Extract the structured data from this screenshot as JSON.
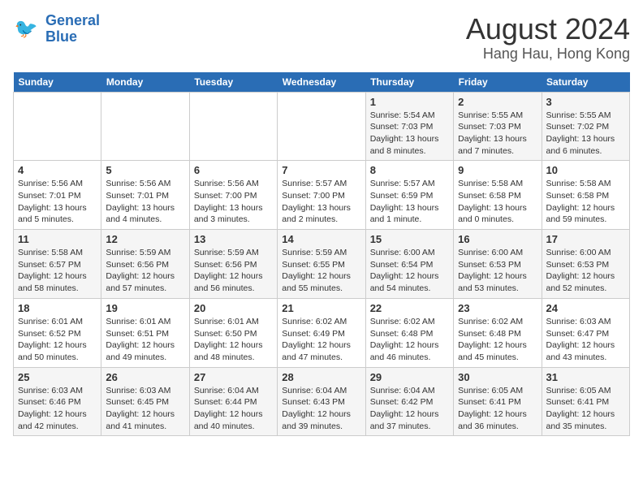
{
  "header": {
    "logo_line1": "General",
    "logo_line2": "Blue",
    "title": "August 2024",
    "subtitle": "Hang Hau, Hong Kong"
  },
  "days_of_week": [
    "Sunday",
    "Monday",
    "Tuesday",
    "Wednesday",
    "Thursday",
    "Friday",
    "Saturday"
  ],
  "weeks": [
    [
      {
        "day": "",
        "info": ""
      },
      {
        "day": "",
        "info": ""
      },
      {
        "day": "",
        "info": ""
      },
      {
        "day": "",
        "info": ""
      },
      {
        "day": "1",
        "info": "Sunrise: 5:54 AM\nSunset: 7:03 PM\nDaylight: 13 hours\nand 8 minutes."
      },
      {
        "day": "2",
        "info": "Sunrise: 5:55 AM\nSunset: 7:03 PM\nDaylight: 13 hours\nand 7 minutes."
      },
      {
        "day": "3",
        "info": "Sunrise: 5:55 AM\nSunset: 7:02 PM\nDaylight: 13 hours\nand 6 minutes."
      }
    ],
    [
      {
        "day": "4",
        "info": "Sunrise: 5:56 AM\nSunset: 7:01 PM\nDaylight: 13 hours\nand 5 minutes."
      },
      {
        "day": "5",
        "info": "Sunrise: 5:56 AM\nSunset: 7:01 PM\nDaylight: 13 hours\nand 4 minutes."
      },
      {
        "day": "6",
        "info": "Sunrise: 5:56 AM\nSunset: 7:00 PM\nDaylight: 13 hours\nand 3 minutes."
      },
      {
        "day": "7",
        "info": "Sunrise: 5:57 AM\nSunset: 7:00 PM\nDaylight: 13 hours\nand 2 minutes."
      },
      {
        "day": "8",
        "info": "Sunrise: 5:57 AM\nSunset: 6:59 PM\nDaylight: 13 hours\nand 1 minute."
      },
      {
        "day": "9",
        "info": "Sunrise: 5:58 AM\nSunset: 6:58 PM\nDaylight: 13 hours\nand 0 minutes."
      },
      {
        "day": "10",
        "info": "Sunrise: 5:58 AM\nSunset: 6:58 PM\nDaylight: 12 hours\nand 59 minutes."
      }
    ],
    [
      {
        "day": "11",
        "info": "Sunrise: 5:58 AM\nSunset: 6:57 PM\nDaylight: 12 hours\nand 58 minutes."
      },
      {
        "day": "12",
        "info": "Sunrise: 5:59 AM\nSunset: 6:56 PM\nDaylight: 12 hours\nand 57 minutes."
      },
      {
        "day": "13",
        "info": "Sunrise: 5:59 AM\nSunset: 6:56 PM\nDaylight: 12 hours\nand 56 minutes."
      },
      {
        "day": "14",
        "info": "Sunrise: 5:59 AM\nSunset: 6:55 PM\nDaylight: 12 hours\nand 55 minutes."
      },
      {
        "day": "15",
        "info": "Sunrise: 6:00 AM\nSunset: 6:54 PM\nDaylight: 12 hours\nand 54 minutes."
      },
      {
        "day": "16",
        "info": "Sunrise: 6:00 AM\nSunset: 6:53 PM\nDaylight: 12 hours\nand 53 minutes."
      },
      {
        "day": "17",
        "info": "Sunrise: 6:00 AM\nSunset: 6:53 PM\nDaylight: 12 hours\nand 52 minutes."
      }
    ],
    [
      {
        "day": "18",
        "info": "Sunrise: 6:01 AM\nSunset: 6:52 PM\nDaylight: 12 hours\nand 50 minutes."
      },
      {
        "day": "19",
        "info": "Sunrise: 6:01 AM\nSunset: 6:51 PM\nDaylight: 12 hours\nand 49 minutes."
      },
      {
        "day": "20",
        "info": "Sunrise: 6:01 AM\nSunset: 6:50 PM\nDaylight: 12 hours\nand 48 minutes."
      },
      {
        "day": "21",
        "info": "Sunrise: 6:02 AM\nSunset: 6:49 PM\nDaylight: 12 hours\nand 47 minutes."
      },
      {
        "day": "22",
        "info": "Sunrise: 6:02 AM\nSunset: 6:48 PM\nDaylight: 12 hours\nand 46 minutes."
      },
      {
        "day": "23",
        "info": "Sunrise: 6:02 AM\nSunset: 6:48 PM\nDaylight: 12 hours\nand 45 minutes."
      },
      {
        "day": "24",
        "info": "Sunrise: 6:03 AM\nSunset: 6:47 PM\nDaylight: 12 hours\nand 43 minutes."
      }
    ],
    [
      {
        "day": "25",
        "info": "Sunrise: 6:03 AM\nSunset: 6:46 PM\nDaylight: 12 hours\nand 42 minutes."
      },
      {
        "day": "26",
        "info": "Sunrise: 6:03 AM\nSunset: 6:45 PM\nDaylight: 12 hours\nand 41 minutes."
      },
      {
        "day": "27",
        "info": "Sunrise: 6:04 AM\nSunset: 6:44 PM\nDaylight: 12 hours\nand 40 minutes."
      },
      {
        "day": "28",
        "info": "Sunrise: 6:04 AM\nSunset: 6:43 PM\nDaylight: 12 hours\nand 39 minutes."
      },
      {
        "day": "29",
        "info": "Sunrise: 6:04 AM\nSunset: 6:42 PM\nDaylight: 12 hours\nand 37 minutes."
      },
      {
        "day": "30",
        "info": "Sunrise: 6:05 AM\nSunset: 6:41 PM\nDaylight: 12 hours\nand 36 minutes."
      },
      {
        "day": "31",
        "info": "Sunrise: 6:05 AM\nSunset: 6:41 PM\nDaylight: 12 hours\nand 35 minutes."
      }
    ]
  ]
}
